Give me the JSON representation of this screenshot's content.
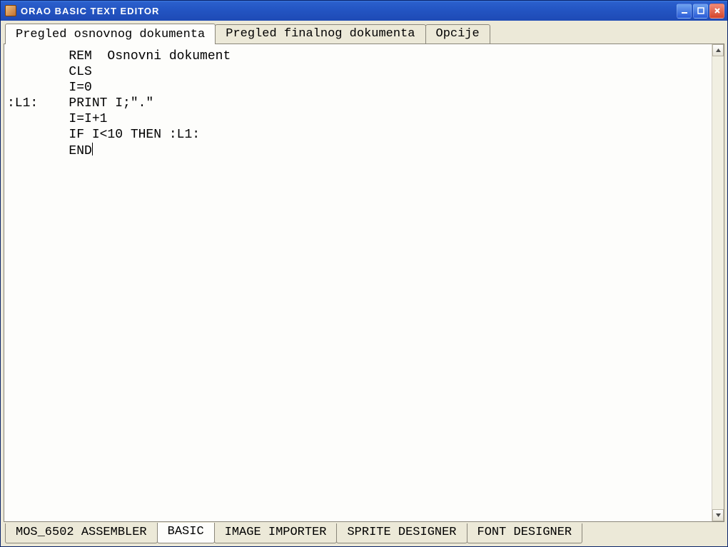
{
  "window": {
    "title": "ORAO  BASIC  TEXT  EDITOR"
  },
  "tabs_top": [
    {
      "label": "Pregled osnovnog dokumenta",
      "active": true
    },
    {
      "label": "Pregled finalnog dokumenta",
      "active": false
    },
    {
      "label": "Opcije",
      "active": false
    }
  ],
  "editor": {
    "lines": [
      "        REM  Osnovni dokument",
      "        CLS",
      "        I=0",
      ":L1:    PRINT I;\".\"",
      "        I=I+1",
      "        IF I<10 THEN :L1:",
      "        END"
    ]
  },
  "tabs_bottom": [
    {
      "label": "MOS_6502 ASSEMBLER",
      "active": false
    },
    {
      "label": "BASIC",
      "active": true
    },
    {
      "label": "IMAGE IMPORTER",
      "active": false
    },
    {
      "label": "SPRITE DESIGNER",
      "active": false
    },
    {
      "label": "FONT DESIGNER",
      "active": false
    }
  ]
}
